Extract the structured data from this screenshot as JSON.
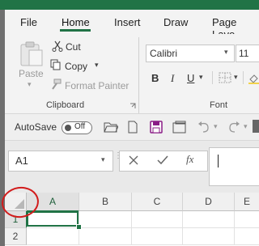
{
  "ribbon_tabs": [
    "File",
    "Home",
    "Insert",
    "Draw",
    "Page Layo"
  ],
  "clipboard": {
    "paste_label": "Paste",
    "cut_label": "Cut",
    "copy_label": "Copy",
    "format_painter_label": "Format Painter",
    "group_label": "Clipboard"
  },
  "font": {
    "font_name": "Calibri",
    "font_size": "11",
    "bold": "B",
    "italic": "I",
    "underline": "U",
    "group_label": "Font"
  },
  "qat": {
    "autosave_label": "AutoSave",
    "autosave_state": "Off"
  },
  "formula_bar": {
    "name_box_value": "A1",
    "fx_label": "fx"
  },
  "sheet": {
    "columns": [
      "A",
      "B",
      "C",
      "D",
      "E"
    ],
    "rows": [
      "1",
      "2"
    ],
    "selected_cell": "A1"
  },
  "colors": {
    "accent": "#217346",
    "annotation": "#d21c1c"
  }
}
